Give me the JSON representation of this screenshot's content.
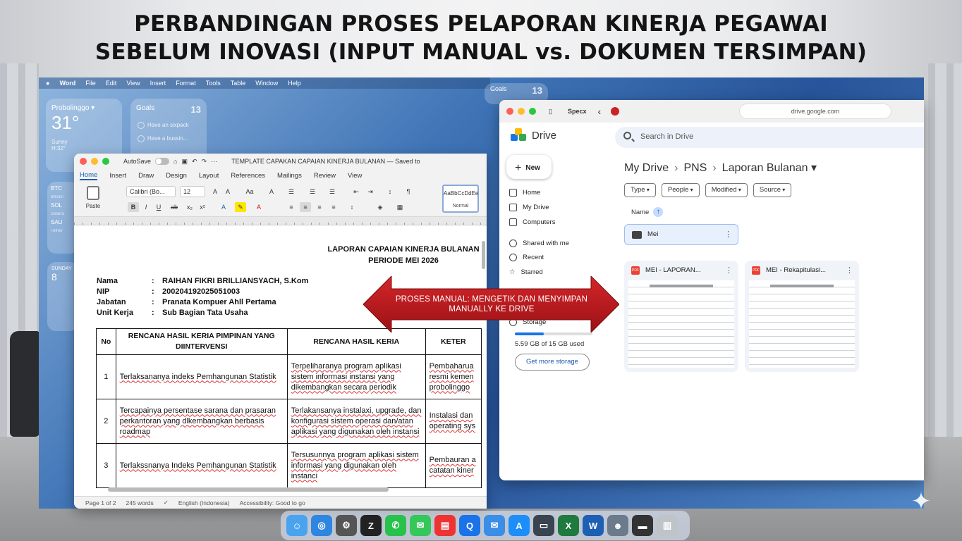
{
  "headline": {
    "line1": "PERBANDINGAN PROSES PELAPORAN KINERJA PEGAWAI",
    "line2": "SEBELUM INOVASI (INPUT MANUAL vs. DOKUMEN TERSIMPAN)"
  },
  "menubar": {
    "app": "Word",
    "items": [
      "File",
      "Edit",
      "View",
      "Insert",
      "Format",
      "Tools",
      "Table",
      "Window",
      "Help"
    ]
  },
  "widgets": {
    "weather": {
      "city": "Probolinggo ▾",
      "temp": "31°",
      "condition": "Sunny",
      "range": "H:32°"
    },
    "goals": {
      "title": "Goals",
      "count": "13",
      "items": [
        "Have an sixpack",
        "Have a bussin..."
      ]
    },
    "goals2": {
      "title": "Goals",
      "count": "13"
    },
    "stocks": [
      {
        "sym": "BTC",
        "note": "Bitcoin"
      },
      {
        "sym": "SOL",
        "note": "Solana"
      },
      {
        "sym": "SAU",
        "note": "Tether"
      }
    ],
    "calendar": {
      "day": "SUNDAY",
      "date": "8"
    }
  },
  "word": {
    "autosave": "AutoSave",
    "doc_title": "TEMPLATE CAPAKAN CAPAIAN KINERJA BULANAN — Saved to",
    "tabs": [
      "Home",
      "Insert",
      "Draw",
      "Design",
      "Layout",
      "References",
      "Mailings",
      "Review",
      "View"
    ],
    "paste": "Paste",
    "font": "Calibri (Bo...",
    "size": "12",
    "style_sample": "AaBbCcDdEe",
    "style_name": "Normal",
    "document": {
      "title1": "LAPORAN CAPAIAN KINERJA BULANAN",
      "title2": "PERIODE MEI 2026",
      "meta": [
        {
          "k": "Nama",
          "v": "RAIHAN FIKRI BRILLIANSYACH, S.Kom"
        },
        {
          "k": "NIP",
          "v": "200204192025051003"
        },
        {
          "k": "Jabatan",
          "v": "Pranata Kompuer Ahll Pertama"
        },
        {
          "k": "Unit Kerja",
          "v": "Sub Bagian Tata Usaha"
        }
      ],
      "table_headers": [
        "No",
        "RENCANA HASIL KERIA PIMPINAN YANG DIINTERVENSI",
        "RENCANA HASIL KERIA",
        "KETER"
      ],
      "rows": [
        {
          "no": "1",
          "a": "Terlaksananya indeks Pemhangunan Statistik",
          "b": "Terpeliharanya program aplikasi sistem informasi instansi yang dikembangkan secara periodik",
          "c": "Pembaharua resmi kemen probolinggo"
        },
        {
          "no": "2",
          "a": "Tercapainya persentase sarana dan prasaran perkantoran yang dlkembangkan berbasis roadmap",
          "b": "Terlakansanya instalaxi, upgrade, dan konfigurasi sistem operasi dan/atan aplikasi yang digunakan oleh instansi",
          "c": "Instalasi dan operating sys"
        },
        {
          "no": "3",
          "a": "Terlakssnanya Indeks Pemhangunan Statistik",
          "b": "Tersusunnya program aplikasi sistem informasi yang digunakan oleh instanci",
          "c": "Pembauran a catatan kiner"
        }
      ]
    },
    "status": {
      "page": "Page 1 of 2",
      "words": "245 words",
      "language": "English (Indonesia)",
      "accessibility": "Accessibility: Good to go"
    }
  },
  "drive": {
    "browser_profile": "Specx",
    "url": "drive.google.com",
    "app_name": "Drive",
    "search_placeholder": "Search in Drive",
    "new_label": "New",
    "nav": [
      "Home",
      "My Drive",
      "Computers",
      "Shared with me",
      "Recent",
      "Starred"
    ],
    "storage_label": "Storage",
    "storage_used": "5.59 GB of 15 GB used",
    "storage_fraction": 0.373,
    "get_more": "Get more storage",
    "breadcrumb": [
      "My Drive",
      "PNS",
      "Laporan Bulanan ▾"
    ],
    "filters": [
      "Type",
      "People",
      "Modified",
      "Source"
    ],
    "sort_label": "Name",
    "sort_arrow": "↑",
    "folder": "Mei",
    "files": [
      "MEI - LAPORAN...",
      "MEI - Rekapitulasi..."
    ]
  },
  "arrow_banner": {
    "line1": "PROSES MANUAL: MENGETIK DAN MENYIMPAN",
    "line2": "MANUALLY KE DRIVE"
  },
  "colors": {
    "arrow_red": "#b5191c",
    "drive_blue": "#1a73e8",
    "word_blue": "#1e5fb4"
  },
  "dock_icons": [
    "finder-icon",
    "safari-icon",
    "settings-icon",
    "editor-icon",
    "whatsapp-icon",
    "messages-icon",
    "calendar-icon",
    "qr-icon",
    "mail-icon",
    "appstore-icon",
    "terminal-icon",
    "excel-icon",
    "word-icon",
    "photo-icon",
    "notes-icon",
    "trash-icon"
  ]
}
